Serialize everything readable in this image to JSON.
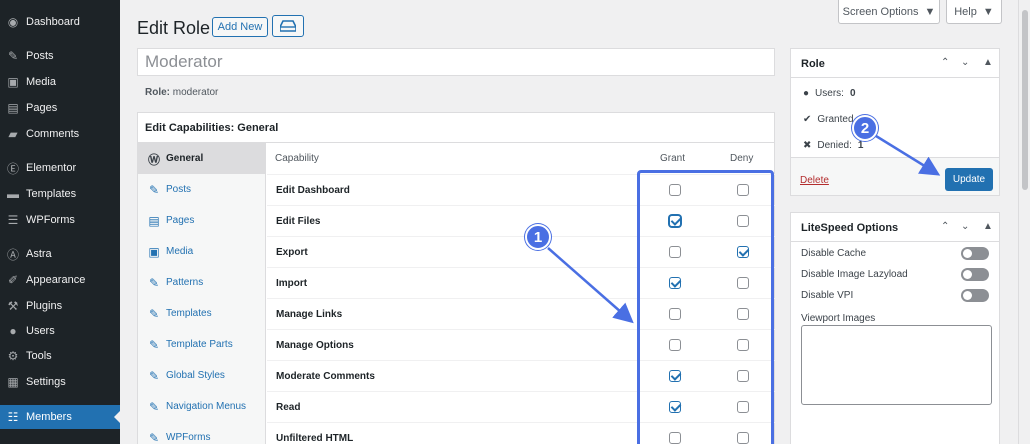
{
  "sidebar": {
    "items": [
      {
        "label": "Dashboard",
        "icon": "dashboard-icon"
      },
      {
        "label": "Posts",
        "icon": "pin-icon"
      },
      {
        "label": "Media",
        "icon": "media-icon"
      },
      {
        "label": "Pages",
        "icon": "pages-icon"
      },
      {
        "label": "Comments",
        "icon": "comments-icon"
      },
      {
        "label": "Elementor",
        "icon": "elementor-icon"
      },
      {
        "label": "Templates",
        "icon": "folder-icon"
      },
      {
        "label": "WPForms",
        "icon": "form-icon"
      },
      {
        "label": "Astra",
        "icon": "astra-icon"
      },
      {
        "label": "Appearance",
        "icon": "brush-icon"
      },
      {
        "label": "Plugins",
        "icon": "plugin-icon"
      },
      {
        "label": "Users",
        "icon": "user-icon"
      },
      {
        "label": "Tools",
        "icon": "wrench-icon"
      },
      {
        "label": "Settings",
        "icon": "settings-icon"
      },
      {
        "label": "Members",
        "icon": "members-icon",
        "active": true
      }
    ]
  },
  "header": {
    "title": "Edit Role",
    "add_new_label": "Add New",
    "screen_options_label": "Screen Options",
    "help_label": "Help"
  },
  "role": {
    "name_value": "Moderator",
    "slug_label": "Role:",
    "slug_value": "moderator"
  },
  "capabilities": {
    "box_title": "Edit Capabilities: General",
    "columns": {
      "capability": "Capability",
      "grant": "Grant",
      "deny": "Deny"
    },
    "tabs": [
      {
        "label": "General",
        "icon": "wordpress-icon",
        "active": true
      },
      {
        "label": "Posts",
        "icon": "pin-icon"
      },
      {
        "label": "Pages",
        "icon": "pages-icon"
      },
      {
        "label": "Media",
        "icon": "media-icon"
      },
      {
        "label": "Patterns",
        "icon": "pin-icon"
      },
      {
        "label": "Templates",
        "icon": "pin-icon"
      },
      {
        "label": "Template Parts",
        "icon": "pin-icon"
      },
      {
        "label": "Global Styles",
        "icon": "pin-icon"
      },
      {
        "label": "Navigation Menus",
        "icon": "pin-icon"
      },
      {
        "label": "WPForms",
        "icon": "pin-icon"
      }
    ],
    "rows": [
      {
        "name": "Edit Dashboard",
        "grant": false,
        "deny": false
      },
      {
        "name": "Edit Files",
        "grant": true,
        "deny": false,
        "grant_focus": true
      },
      {
        "name": "Export",
        "grant": false,
        "deny": true
      },
      {
        "name": "Import",
        "grant": true,
        "deny": false
      },
      {
        "name": "Manage Links",
        "grant": false,
        "deny": false
      },
      {
        "name": "Manage Options",
        "grant": false,
        "deny": false
      },
      {
        "name": "Moderate Comments",
        "grant": true,
        "deny": false
      },
      {
        "name": "Read",
        "grant": true,
        "deny": false
      },
      {
        "name": "Unfiltered HTML",
        "grant": false,
        "deny": false
      }
    ]
  },
  "role_box": {
    "title": "Role",
    "users_label": "Users:",
    "users_count": "0",
    "granted_label": "Granted",
    "denied_label": "Denied:",
    "denied_count": "1",
    "delete_label": "Delete",
    "update_label": "Update"
  },
  "litespeed": {
    "title": "LiteSpeed Options",
    "options": [
      {
        "label": "Disable Cache",
        "enabled": false
      },
      {
        "label": "Disable Image Lazyload",
        "enabled": false
      },
      {
        "label": "Disable VPI",
        "enabled": false
      }
    ],
    "viewport_label": "Viewport Images"
  },
  "annotations": {
    "badge_1": "1",
    "badge_2": "2",
    "color": "#4a6fe3"
  }
}
